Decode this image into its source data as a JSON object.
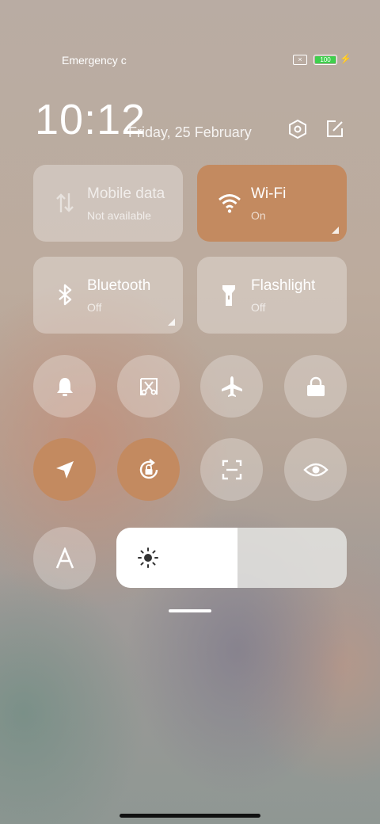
{
  "status_bar": {
    "carrier": "Emergency c",
    "sim_icon": "sim-off-icon",
    "battery": "100",
    "charging_icon": "bolt-icon"
  },
  "header": {
    "time": "10:12",
    "date": "Friday, 25 February",
    "icons": [
      "settings-hexagon-icon",
      "edit-icon"
    ]
  },
  "tiles": [
    {
      "name": "Mobile data",
      "status": "Not available",
      "icon": "mobile-data-icon",
      "active": false
    },
    {
      "name": "Wi-Fi",
      "status": "On",
      "icon": "wifi-icon",
      "active": true
    },
    {
      "name": "Bluetooth",
      "status": "Off",
      "icon": "bluetooth-icon",
      "active": false
    },
    {
      "name": "Flashlight",
      "status": "Off",
      "icon": "flashlight-icon",
      "active": false
    }
  ],
  "toggles": [
    {
      "icon": "bell-icon",
      "active": false
    },
    {
      "icon": "screenshot-icon",
      "active": false
    },
    {
      "icon": "airplane-icon",
      "active": false
    },
    {
      "icon": "lock-icon",
      "active": false
    },
    {
      "icon": "location-icon",
      "active": true
    },
    {
      "icon": "rotation-lock-icon",
      "active": true
    },
    {
      "icon": "scanner-icon",
      "active": false
    },
    {
      "icon": "eye-icon",
      "active": false
    },
    {
      "icon": "font-size-icon",
      "active": false
    }
  ],
  "brightness": {
    "level": 0.525,
    "icon": "sun-icon"
  },
  "colors": {
    "accent": "#c38a60",
    "battery": "#3fd04d"
  }
}
